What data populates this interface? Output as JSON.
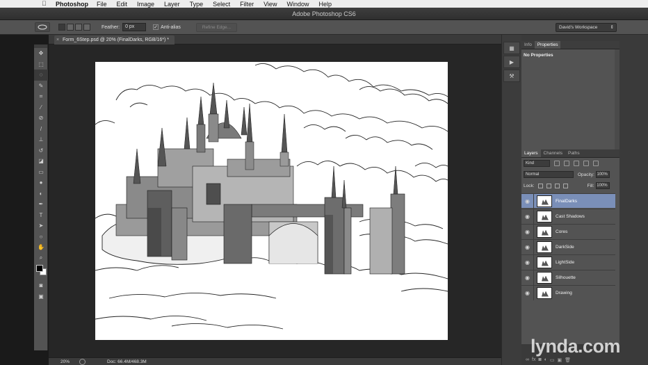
{
  "menubar": {
    "app": "Photoshop",
    "items": [
      "File",
      "Edit",
      "Image",
      "Layer",
      "Type",
      "Select",
      "Filter",
      "View",
      "Window",
      "Help"
    ]
  },
  "window": {
    "title": "Adobe Photoshop CS6"
  },
  "options": {
    "feather_label": "Feather:",
    "feather_value": "0 px",
    "antialias_label": "Anti-alias",
    "refine_edge": "Refine Edge...",
    "workspace": "David's Workspace"
  },
  "tools": [
    "move",
    "marquee",
    "lasso",
    "quick-select",
    "crop",
    "eyedropper",
    "spot-heal",
    "brush",
    "clone-stamp",
    "history-brush",
    "eraser",
    "gradient",
    "blur",
    "dodge",
    "pen",
    "type",
    "path-select",
    "ellipse",
    "hand",
    "zoom"
  ],
  "document": {
    "tab": "Form_6Step.psd @ 20% (FinalDarks, RGB/16*) *",
    "zoom": "20%",
    "doc_size": "Doc: 66.4M/468.3M"
  },
  "properties_panel": {
    "tabs": [
      "Info",
      "Properties"
    ],
    "active_tab": "Properties",
    "empty_text": "No Properties"
  },
  "layers_panel": {
    "tabs": [
      "Layers",
      "Channels",
      "Paths"
    ],
    "active_tab": "Layers",
    "filter_kind": "Kind",
    "blend_mode": "Normal",
    "opacity_label": "Opacity:",
    "opacity_value": "100%",
    "lock_label": "Lock:",
    "fill_label": "Fill:",
    "fill_value": "100%",
    "layers": [
      {
        "name": "FinalDarks",
        "selected": true
      },
      {
        "name": "Cast Shadows",
        "selected": false
      },
      {
        "name": "Cores",
        "selected": false
      },
      {
        "name": "DarkSide",
        "selected": false
      },
      {
        "name": "LightSide",
        "selected": false
      },
      {
        "name": "Silhouette",
        "selected": false
      },
      {
        "name": "Drawing",
        "selected": false
      }
    ]
  },
  "watermark": "lynda.com",
  "colors": {
    "selected_layer": "#7a8fb8",
    "panel": "#535353",
    "canvas_bg": "#262626"
  }
}
